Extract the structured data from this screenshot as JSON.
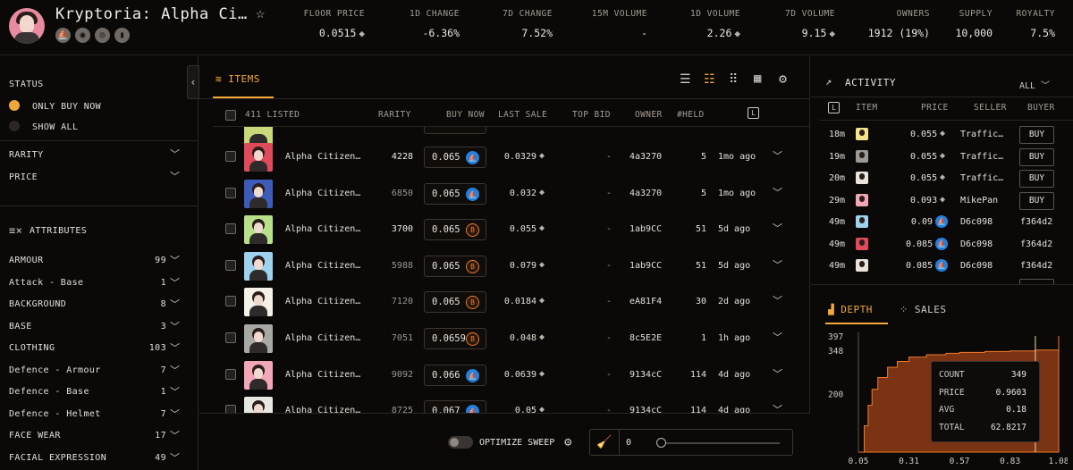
{
  "collection": {
    "title": "Kryptoria: Alpha Ci…",
    "header_icons": [
      "opensea-icon",
      "eye-icon",
      "target-icon",
      "chart-bar-icon"
    ]
  },
  "stats": [
    {
      "label": "FLOOR PRICE",
      "value": "0.0515",
      "eth": true
    },
    {
      "label": "1D CHANGE",
      "value": "-6.36%",
      "tone": "neg"
    },
    {
      "label": "7D CHANGE",
      "value": "7.52%",
      "tone": "pos"
    },
    {
      "label": "15M VOLUME",
      "value": "-"
    },
    {
      "label": "1D VOLUME",
      "value": "2.26",
      "eth": true
    },
    {
      "label": "7D VOLUME",
      "value": "9.15",
      "eth": true
    },
    {
      "label": "OWNERS",
      "value": "1912 (19%)"
    },
    {
      "label": "SUPPLY",
      "value": "10,000"
    },
    {
      "label": "ROYALTY",
      "value": "7.5%"
    }
  ],
  "filters": {
    "status_label": "STATUS",
    "only_buy_now": "ONLY BUY NOW",
    "show_all": "SHOW ALL",
    "rarity": "RARITY",
    "price": "PRICE",
    "attributes_label": "ATTRIBUTES",
    "attributes": [
      {
        "name": "ARMOUR",
        "count": "99"
      },
      {
        "name": "Attack - Base",
        "count": "1"
      },
      {
        "name": "BACKGROUND",
        "count": "8"
      },
      {
        "name": "BASE",
        "count": "3"
      },
      {
        "name": "CLOTHING",
        "count": "103"
      },
      {
        "name": "Defence - Armour",
        "count": "7"
      },
      {
        "name": "Defence - Base",
        "count": "1"
      },
      {
        "name": "Defence - Helmet",
        "count": "7"
      },
      {
        "name": "FACE WEAR",
        "count": "17"
      },
      {
        "name": "FACIAL EXPRESSION",
        "count": "49"
      }
    ]
  },
  "items": {
    "tab_label": "ITEMS",
    "listed": "411 LISTED",
    "columns": {
      "rarity": "RARITY",
      "buy_now": "BUY NOW",
      "last_sale": "LAST SALE",
      "top_bid": "TOP BID",
      "owner": "OWNER",
      "held": "#HELD"
    },
    "rows": [
      {
        "name": "Alpha Citizen…",
        "rarity": "4228",
        "price": "0.065",
        "market": "opensea",
        "last": "0.0329",
        "bid": "-",
        "owner": "4a3270",
        "held": "5",
        "time": "1mo ago",
        "bg": "#e04b5b"
      },
      {
        "name": "Alpha Citizen…",
        "rarity": "6850",
        "price": "0.065",
        "market": "opensea",
        "last": "0.032",
        "bid": "-",
        "owner": "4a3270",
        "held": "5",
        "time": "1mo ago",
        "bg": "#3d5bb8"
      },
      {
        "name": "Alpha Citizen…",
        "rarity": "3700",
        "price": "0.065",
        "market": "blur",
        "last": "0.055",
        "bid": "-",
        "owner": "1ab9CC",
        "held": "51",
        "time": "5d ago",
        "bg": "#b8e08a"
      },
      {
        "name": "Alpha Citizen…",
        "rarity": "5988",
        "price": "0.065",
        "market": "blur",
        "last": "0.079",
        "bid": "-",
        "owner": "1ab9CC",
        "held": "51",
        "time": "5d ago",
        "bg": "#9ed2ee"
      },
      {
        "name": "Alpha Citizen…",
        "rarity": "7120",
        "price": "0.065",
        "market": "blur",
        "last": "0.0184",
        "bid": "-",
        "owner": "eA81F4",
        "held": "30",
        "time": "2d ago",
        "bg": "#f4f1e6"
      },
      {
        "name": "Alpha Citizen…",
        "rarity": "7051",
        "price": "0.0659",
        "market": "blur",
        "last": "0.048",
        "bid": "-",
        "owner": "8c5E2E",
        "held": "1",
        "time": "1h ago",
        "bg": "#a8a8a4"
      },
      {
        "name": "Alpha Citizen…",
        "rarity": "9092",
        "price": "0.066",
        "market": "opensea",
        "last": "0.0639",
        "bid": "-",
        "owner": "9134cC",
        "held": "114",
        "time": "4d ago",
        "bg": "#f2a7b8"
      },
      {
        "name": "Alpha Citizen…",
        "rarity": "8725",
        "price": "0.067",
        "market": "opensea",
        "last": "0.05",
        "bid": "-",
        "owner": "9134cC",
        "held": "114",
        "time": "4d ago",
        "bg": "#e8e8e2"
      }
    ]
  },
  "sweep": {
    "label": "OPTIMIZE SWEEP",
    "count": "0"
  },
  "activity": {
    "title": "ACTIVITY",
    "filter": "ALL",
    "columns": {
      "item": "ITEM",
      "price": "PRICE",
      "seller": "SELLER",
      "buyer": "BUYER"
    },
    "rows": [
      {
        "time": "18m",
        "price": "0.055",
        "eth": true,
        "seller": "Traffic…",
        "buyer": "BUY",
        "button": true,
        "color": "#f2e28a"
      },
      {
        "time": "19m",
        "price": "0.055",
        "eth": true,
        "seller": "Traffic…",
        "buyer": "BUY",
        "button": true,
        "color": "#9a9a96"
      },
      {
        "time": "20m",
        "price": "0.055",
        "eth": true,
        "seller": "Traffic…",
        "buyer": "BUY",
        "button": true,
        "color": "#e8e4dc"
      },
      {
        "time": "29m",
        "price": "0.093",
        "eth": true,
        "seller": "MikePan",
        "buyer": "BUY",
        "button": true,
        "color": "#f2a7b8"
      },
      {
        "time": "49m",
        "price": "0.09",
        "eth": false,
        "seller": "D6c098",
        "buyer": "f364d2",
        "button": false,
        "color": "#9ed2ee"
      },
      {
        "time": "49m",
        "price": "0.085",
        "eth": false,
        "seller": "D6c098",
        "buyer": "f364d2",
        "button": false,
        "color": "#e04b5b"
      },
      {
        "time": "49m",
        "price": "0.085",
        "eth": false,
        "seller": "D6c098",
        "buyer": "f364d2",
        "button": false,
        "color": "#e8e4dc"
      }
    ]
  },
  "depth": {
    "tab_depth": "DEPTH",
    "tab_sales": "SALES",
    "y_ticks": [
      "397",
      "348",
      "200"
    ],
    "x_ticks": [
      "0.05",
      "0.31",
      "0.57",
      "0.83",
      "1.08"
    ],
    "tooltip": [
      {
        "label": "COUNT",
        "value": "349"
      },
      {
        "label": "PRICE",
        "value": "0.9603"
      },
      {
        "label": "AVG",
        "value": "0.18"
      },
      {
        "label": "TOTAL",
        "value": "62.8217"
      }
    ]
  },
  "chart_data": {
    "type": "area",
    "x": [
      0.05,
      0.08,
      0.1,
      0.12,
      0.15,
      0.2,
      0.25,
      0.31,
      0.4,
      0.5,
      0.57,
      0.7,
      0.83,
      0.96,
      1.08
    ],
    "y": [
      0,
      90,
      160,
      215,
      255,
      290,
      310,
      325,
      333,
      338,
      341,
      344,
      346,
      349,
      397
    ],
    "ylim": [
      0,
      397
    ],
    "xlim": [
      0.05,
      1.08
    ]
  },
  "colors": {
    "accent": "#f0a83a",
    "negative": "#ff5f5f",
    "positive": "#6fdc7a",
    "depth_fill": "#7a3414",
    "depth_line": "#f07a2a"
  }
}
